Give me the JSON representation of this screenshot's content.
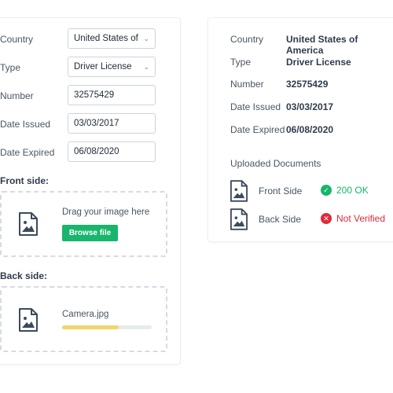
{
  "form": {
    "country": {
      "label": "Country",
      "value": "United States of"
    },
    "type": {
      "label": "Type",
      "value": "Driver License"
    },
    "number": {
      "label": "Number",
      "value": "32575429"
    },
    "date_issued": {
      "label": "Date Issued",
      "value": "03/03/2017"
    },
    "date_expired": {
      "label": "Date Expired",
      "value": "06/08/2020"
    },
    "front_side": {
      "label": "Front side:",
      "drag_text": "Drag your image here",
      "browse_label": "Browse file"
    },
    "back_side": {
      "label": "Back side:",
      "file_name": "Camera.jpg",
      "upload_progress": 0.63
    }
  },
  "summary": {
    "rows": [
      {
        "label": "Country",
        "value": "United States of America"
      },
      {
        "label": "Type",
        "value": "Driver License"
      },
      {
        "label": "Number",
        "value": "32575429"
      },
      {
        "label": "Date Issued",
        "value": "03/03/2017"
      },
      {
        "label": "Date Expired",
        "value": "06/08/2020"
      }
    ],
    "uploaded_title": "Uploaded Documents",
    "documents": [
      {
        "label": "Front Side",
        "status": "200 OK",
        "status_type": "ok",
        "icon": "check-icon"
      },
      {
        "label": "Back Side",
        "status": "Not Verified",
        "status_type": "error",
        "icon": "x-icon"
      }
    ]
  },
  "colors": {
    "accent_green": "#18b56d",
    "ok": "#18b56d",
    "error": "#e02a3a",
    "progress": "#f4d36a"
  }
}
